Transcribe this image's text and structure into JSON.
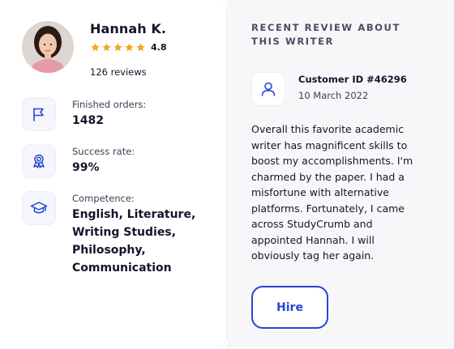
{
  "writer": {
    "name": "Hannah K.",
    "rating": "4.8",
    "stars": 5,
    "reviews": "126 reviews",
    "avatar_icon": "writer-avatar"
  },
  "stats": {
    "orders": {
      "label": "Finished orders:",
      "value": "1482",
      "icon": "flag-icon"
    },
    "success": {
      "label": "Success rate:",
      "value": "99%",
      "icon": "award-ribbon-icon"
    },
    "competence": {
      "label": "Competence:",
      "value": "English, Literature, Writing Studies, Philosophy, Communication",
      "icon": "graduation-cap-icon"
    }
  },
  "review": {
    "section_title": "RECENT REVIEW ABOUT THIS WRITER",
    "customer_id": "Customer ID #46296",
    "date": "10 March 2022",
    "text": "Overall this favorite academic writer has magnificent skills to boost my accomplishments. I'm charmed by the paper. I had a misfortune with alternative platforms. Fortunately, I came across StudyCrumb and appointed Hannah. I will obviously tag her again.",
    "customer_icon": "user-icon"
  },
  "actions": {
    "hire_label": "Hire"
  },
  "colors": {
    "accent": "#2546d6",
    "star": "#f5a623",
    "panel_bg": "#f7f7fa"
  }
}
